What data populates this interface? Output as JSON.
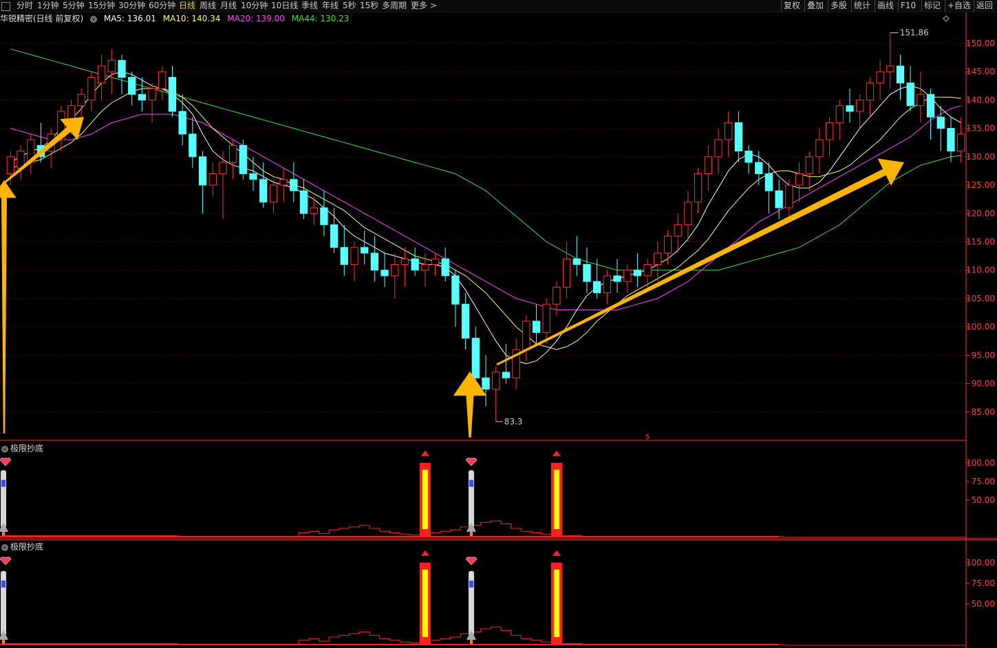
{
  "toolbar": {
    "periods": [
      "分时",
      "1分钟",
      "5分钟",
      "15分钟",
      "30分钟",
      "60分钟",
      "日线",
      "周线",
      "月线",
      "10分钟",
      "10日线",
      "季线",
      "年线",
      "5秒",
      "15秒",
      "多周期",
      "更多 >"
    ],
    "active_period": "日线",
    "right_items": [
      "复权",
      "叠加",
      "多股",
      "统计",
      "画线",
      "F10",
      "标记",
      "+自选",
      "返回"
    ]
  },
  "title": {
    "name": "华锐精密(日线 前复权)",
    "ma": [
      {
        "label": "MA5: 136.01",
        "color": "#ffffff"
      },
      {
        "label": "MA10: 140.34",
        "color": "#ffff66"
      },
      {
        "label": "MA20: 139.00",
        "color": "#ff44ff"
      },
      {
        "label": "MA44: 130.23",
        "color": "#44dd44"
      }
    ]
  },
  "colors": {
    "up": "#ff3232",
    "down": "#54ffff",
    "grid": "#5a0000",
    "axis": "#ff3232",
    "arrow": "#ffb400",
    "ma5": "#ffffff",
    "ma10": "#ffff66",
    "ma20": "#ff44ff",
    "ma44": "#44dd44"
  },
  "chart_data": [
    {
      "type": "candlestick",
      "title": "华锐精密(日线 前复权)",
      "ylim": [
        80,
        154
      ],
      "yticks": [
        "150.00",
        "145.00",
        "140.00",
        "135.00",
        "130.00",
        "125.00",
        "120.00",
        "115.00",
        "110.00",
        "105.00",
        "100.00",
        "95.00",
        "90.00",
        "85.00"
      ],
      "annotations": {
        "high": "151.86",
        "low": "83.3"
      },
      "marker": "$",
      "ohlc": [
        [
          127,
          131,
          125,
          130
        ],
        [
          128,
          132,
          126,
          131
        ],
        [
          129,
          134,
          127,
          133
        ],
        [
          132,
          136,
          129,
          130
        ],
        [
          131,
          135,
          128,
          134
        ],
        [
          133,
          139,
          131,
          138
        ],
        [
          136,
          140,
          134,
          139
        ],
        [
          139,
          142,
          136,
          141
        ],
        [
          140,
          145,
          138,
          144
        ],
        [
          143,
          148,
          140,
          146
        ],
        [
          145,
          149,
          141,
          147
        ],
        [
          147,
          148,
          141,
          144
        ],
        [
          144,
          145,
          139,
          141
        ],
        [
          141,
          144,
          138,
          140
        ],
        [
          140,
          143,
          136,
          142
        ],
        [
          142,
          146,
          140,
          145
        ],
        [
          144,
          146,
          137,
          138
        ],
        [
          138,
          141,
          132,
          134
        ],
        [
          134,
          137,
          128,
          130
        ],
        [
          130,
          131,
          120,
          125
        ],
        [
          125,
          129,
          123,
          127
        ],
        [
          127,
          131,
          119,
          129
        ],
        [
          129,
          133,
          126,
          132
        ],
        [
          132,
          133,
          126,
          127
        ],
        [
          127,
          130,
          124,
          126
        ],
        [
          126,
          129,
          121,
          122
        ],
        [
          122,
          126,
          120,
          125
        ],
        [
          125,
          128,
          122,
          126
        ],
        [
          126,
          129,
          122,
          124
        ],
        [
          124,
          126,
          119,
          120
        ],
        [
          120,
          123,
          118,
          121
        ],
        [
          121,
          124,
          116,
          118
        ],
        [
          118,
          121,
          113,
          114
        ],
        [
          114,
          118,
          109,
          111
        ],
        [
          111,
          115,
          108,
          114
        ],
        [
          114,
          117,
          111,
          113
        ],
        [
          113,
          116,
          108,
          110
        ],
        [
          110,
          113,
          107,
          109
        ],
        [
          109,
          113,
          105,
          111
        ],
        [
          111,
          114,
          107,
          112
        ],
        [
          112,
          114,
          109,
          110
        ],
        [
          110,
          113,
          107,
          111
        ],
        [
          111,
          113,
          109,
          112
        ],
        [
          112,
          114,
          108,
          109
        ],
        [
          109,
          110,
          100,
          104
        ],
        [
          104,
          106,
          96,
          98
        ],
        [
          98,
          100,
          88,
          91
        ],
        [
          91,
          95,
          86,
          89
        ],
        [
          89,
          93,
          83.3,
          92
        ],
        [
          92,
          97,
          90,
          91
        ],
        [
          91,
          98,
          89,
          96
        ],
        [
          96,
          102,
          94,
          101
        ],
        [
          101,
          104,
          97,
          99
        ],
        [
          99,
          105,
          97,
          104
        ],
        [
          104,
          108,
          102,
          107
        ],
        [
          107,
          115,
          105,
          112
        ],
        [
          112,
          116,
          109,
          111
        ],
        [
          111,
          114,
          106,
          108
        ],
        [
          108,
          112,
          105,
          106
        ],
        [
          106,
          110,
          104,
          109
        ],
        [
          109,
          112,
          106,
          108
        ],
        [
          108,
          111,
          106,
          110
        ],
        [
          110,
          113,
          107,
          109
        ],
        [
          109,
          112,
          107,
          111
        ],
        [
          111,
          115,
          108,
          113
        ],
        [
          113,
          117,
          111,
          116
        ],
        [
          116,
          120,
          113,
          118
        ],
        [
          118,
          124,
          115,
          122
        ],
        [
          122,
          128,
          120,
          127
        ],
        [
          127,
          132,
          124,
          130
        ],
        [
          130,
          135,
          127,
          133
        ],
        [
          133,
          138,
          130,
          136
        ],
        [
          136,
          138,
          129,
          131
        ],
        [
          131,
          132,
          127,
          129
        ],
        [
          129,
          131,
          125,
          127
        ],
        [
          127,
          129,
          120,
          124
        ],
        [
          124,
          126,
          119,
          121
        ],
        [
          121,
          126,
          119,
          125
        ],
        [
          125,
          129,
          122,
          127
        ],
        [
          127,
          131,
          124,
          130
        ],
        [
          130,
          135,
          127,
          133
        ],
        [
          133,
          137,
          130,
          136
        ],
        [
          136,
          140,
          133,
          139
        ],
        [
          139,
          142,
          136,
          138
        ],
        [
          138,
          141,
          135,
          140
        ],
        [
          140,
          144,
          137,
          143
        ],
        [
          143,
          147,
          140,
          145
        ],
        [
          145,
          151.86,
          142,
          146
        ],
        [
          146,
          148,
          140,
          143
        ],
        [
          143,
          146,
          138,
          139
        ],
        [
          139,
          145,
          136,
          141
        ],
        [
          141,
          142,
          133,
          137
        ],
        [
          137,
          139,
          131,
          135
        ],
        [
          135,
          137,
          129,
          131
        ],
        [
          131,
          137,
          129,
          134
        ]
      ],
      "ma5": [
        129,
        130,
        131,
        131.5,
        133,
        135,
        136.5,
        138.5,
        141,
        143,
        144.5,
        145,
        144.5,
        143.5,
        142.5,
        142,
        141,
        139.5,
        137.5,
        134,
        131,
        129.5,
        128.5,
        128,
        127.5,
        126.5,
        125.5,
        125,
        124.5,
        123.5,
        122.5,
        121,
        119.5,
        117.5,
        116,
        115,
        114,
        113,
        112.5,
        112,
        111.5,
        111,
        111,
        110.5,
        109,
        106.5,
        103.5,
        100.5,
        97.5,
        95,
        94,
        93.5,
        94,
        95.5,
        97.5,
        100,
        103,
        105.5,
        107,
        108,
        108.5,
        109,
        109.5,
        110,
        111,
        112,
        113.5,
        115.5,
        118,
        121.5,
        124.5,
        127.5,
        129.5,
        130.5,
        130,
        128.5,
        126.5,
        125,
        124.5,
        124.5,
        125.5,
        127.5,
        130,
        132.5,
        135,
        137,
        139,
        141,
        142,
        142.5,
        142,
        140.5,
        138.5,
        137,
        136
      ],
      "ma10": [
        128,
        128.5,
        129,
        129.5,
        130.5,
        131.5,
        132.5,
        134,
        136,
        138,
        139.5,
        140.5,
        141.5,
        142,
        142,
        142,
        141.5,
        140.5,
        139,
        137,
        135,
        133.5,
        132,
        130.5,
        129,
        127.5,
        126.5,
        126,
        125,
        124.5,
        123.5,
        122.5,
        121.5,
        120.5,
        119,
        117.5,
        116.5,
        115.5,
        114.5,
        113.5,
        112.5,
        112,
        111.5,
        111,
        110,
        109,
        107.5,
        106,
        104,
        102,
        100,
        98.5,
        97,
        96.5,
        96,
        96.5,
        97.5,
        99,
        101,
        102.5,
        104,
        105.5,
        106.5,
        107.5,
        108.5,
        109.5,
        110.5,
        112,
        113.5,
        115.5,
        118,
        120.5,
        122.5,
        124.5,
        126,
        127,
        127.5,
        127.5,
        127,
        126.5,
        126.5,
        127,
        127.5,
        128.5,
        130,
        131.5,
        133,
        135,
        137,
        138.5,
        139.5,
        140.5,
        140.5,
        140.5,
        140.3
      ],
      "ma20": [
        135,
        134.5,
        134,
        133.5,
        133,
        133,
        133,
        133.5,
        134,
        135,
        136,
        136.5,
        137,
        137.5,
        137.5,
        137.5,
        137.5,
        137,
        136.5,
        136,
        135,
        134,
        133,
        132,
        131,
        130,
        129,
        128,
        127,
        126,
        125,
        124,
        123,
        122,
        121,
        120,
        119,
        118,
        117,
        116,
        115,
        114,
        113,
        112,
        111,
        110,
        109,
        108,
        107,
        106,
        105,
        104.5,
        104,
        103.5,
        103,
        103,
        103,
        103,
        103,
        103,
        103,
        103.5,
        104,
        104.5,
        105,
        106,
        107,
        108,
        109.5,
        111,
        112.5,
        114,
        115.5,
        117,
        118.5,
        119.5,
        120.5,
        121.5,
        122.5,
        123.5,
        124.5,
        125.5,
        126.5,
        127.5,
        128.5,
        129.5,
        130.5,
        131.5,
        132.5,
        133.5,
        135,
        136.5,
        137.5,
        138.5,
        139
      ],
      "ma44": [
        149,
        148.5,
        148,
        147.5,
        147,
        146.5,
        146,
        145.5,
        145,
        144.5,
        144,
        143.5,
        143,
        142.5,
        142,
        141.5,
        141,
        140.5,
        140,
        139.5,
        139,
        138.5,
        138,
        137.5,
        137,
        136.5,
        136,
        135.5,
        135,
        134.5,
        134,
        133.5,
        133,
        132.5,
        132,
        131.5,
        131,
        130.5,
        130,
        129.5,
        129,
        128.5,
        128,
        127.5,
        127,
        126,
        125,
        124,
        122.5,
        121,
        119.5,
        118,
        116.5,
        115,
        114,
        113,
        112,
        111.5,
        111,
        110.5,
        110,
        110,
        110,
        110,
        110,
        110,
        110,
        110,
        110,
        110,
        110,
        110.5,
        111,
        111.5,
        112,
        112.5,
        113,
        113.5,
        114,
        115,
        116,
        117,
        118,
        119.5,
        121,
        122.5,
        124,
        125.5,
        126.5,
        127.5,
        128.5,
        129,
        129.5,
        130,
        130.2
      ]
    },
    {
      "type": "bar",
      "title": "极限抄底",
      "yticks": [
        "100.00",
        "75.00",
        "50.00"
      ],
      "ylim": [
        0,
        110
      ],
      "spikes": [
        {
          "index": 41,
          "value": 100
        },
        {
          "index": 54,
          "value": 100
        }
      ],
      "values": [
        2,
        2,
        2,
        2,
        2,
        2,
        2,
        2,
        2,
        2,
        2,
        2,
        2,
        2,
        2,
        2,
        2,
        1,
        1,
        1,
        1,
        1,
        1,
        1,
        1,
        1,
        1,
        1,
        1,
        6,
        8,
        5,
        10,
        12,
        14,
        16,
        12,
        8,
        6,
        4,
        3,
        2,
        6,
        8,
        10,
        14,
        16,
        20,
        22,
        18,
        12,
        8,
        6,
        4,
        3,
        2,
        2,
        1,
        1,
        1,
        1,
        1,
        1,
        1,
        1,
        1,
        1,
        1,
        1,
        1,
        1,
        1,
        1,
        1,
        1,
        1,
        1,
        0,
        0,
        0,
        0,
        0,
        0,
        0,
        0,
        0,
        0,
        0,
        0,
        0,
        0,
        0,
        0,
        0,
        0
      ]
    },
    {
      "type": "bar",
      "title": "极限抄底",
      "yticks": [
        "100.00",
        "75.00",
        "50.00"
      ],
      "ylim": [
        0,
        110
      ],
      "spikes": [
        {
          "index": 41,
          "value": 100
        },
        {
          "index": 54,
          "value": 100
        }
      ],
      "values": [
        2,
        2,
        2,
        2,
        2,
        2,
        2,
        2,
        2,
        2,
        2,
        2,
        2,
        2,
        2,
        2,
        2,
        1,
        1,
        1,
        1,
        1,
        1,
        1,
        1,
        1,
        1,
        1,
        1,
        6,
        8,
        5,
        10,
        12,
        14,
        16,
        12,
        8,
        6,
        4,
        3,
        2,
        6,
        8,
        10,
        14,
        16,
        20,
        22,
        18,
        12,
        8,
        6,
        4,
        3,
        2,
        2,
        1,
        1,
        1,
        1,
        1,
        1,
        1,
        1,
        1,
        1,
        1,
        1,
        1,
        1,
        1,
        1,
        1,
        1,
        1,
        1,
        0,
        0,
        0,
        0,
        0,
        0,
        0,
        0,
        0,
        0,
        0,
        0,
        0,
        0,
        0,
        0,
        0,
        0
      ]
    }
  ]
}
